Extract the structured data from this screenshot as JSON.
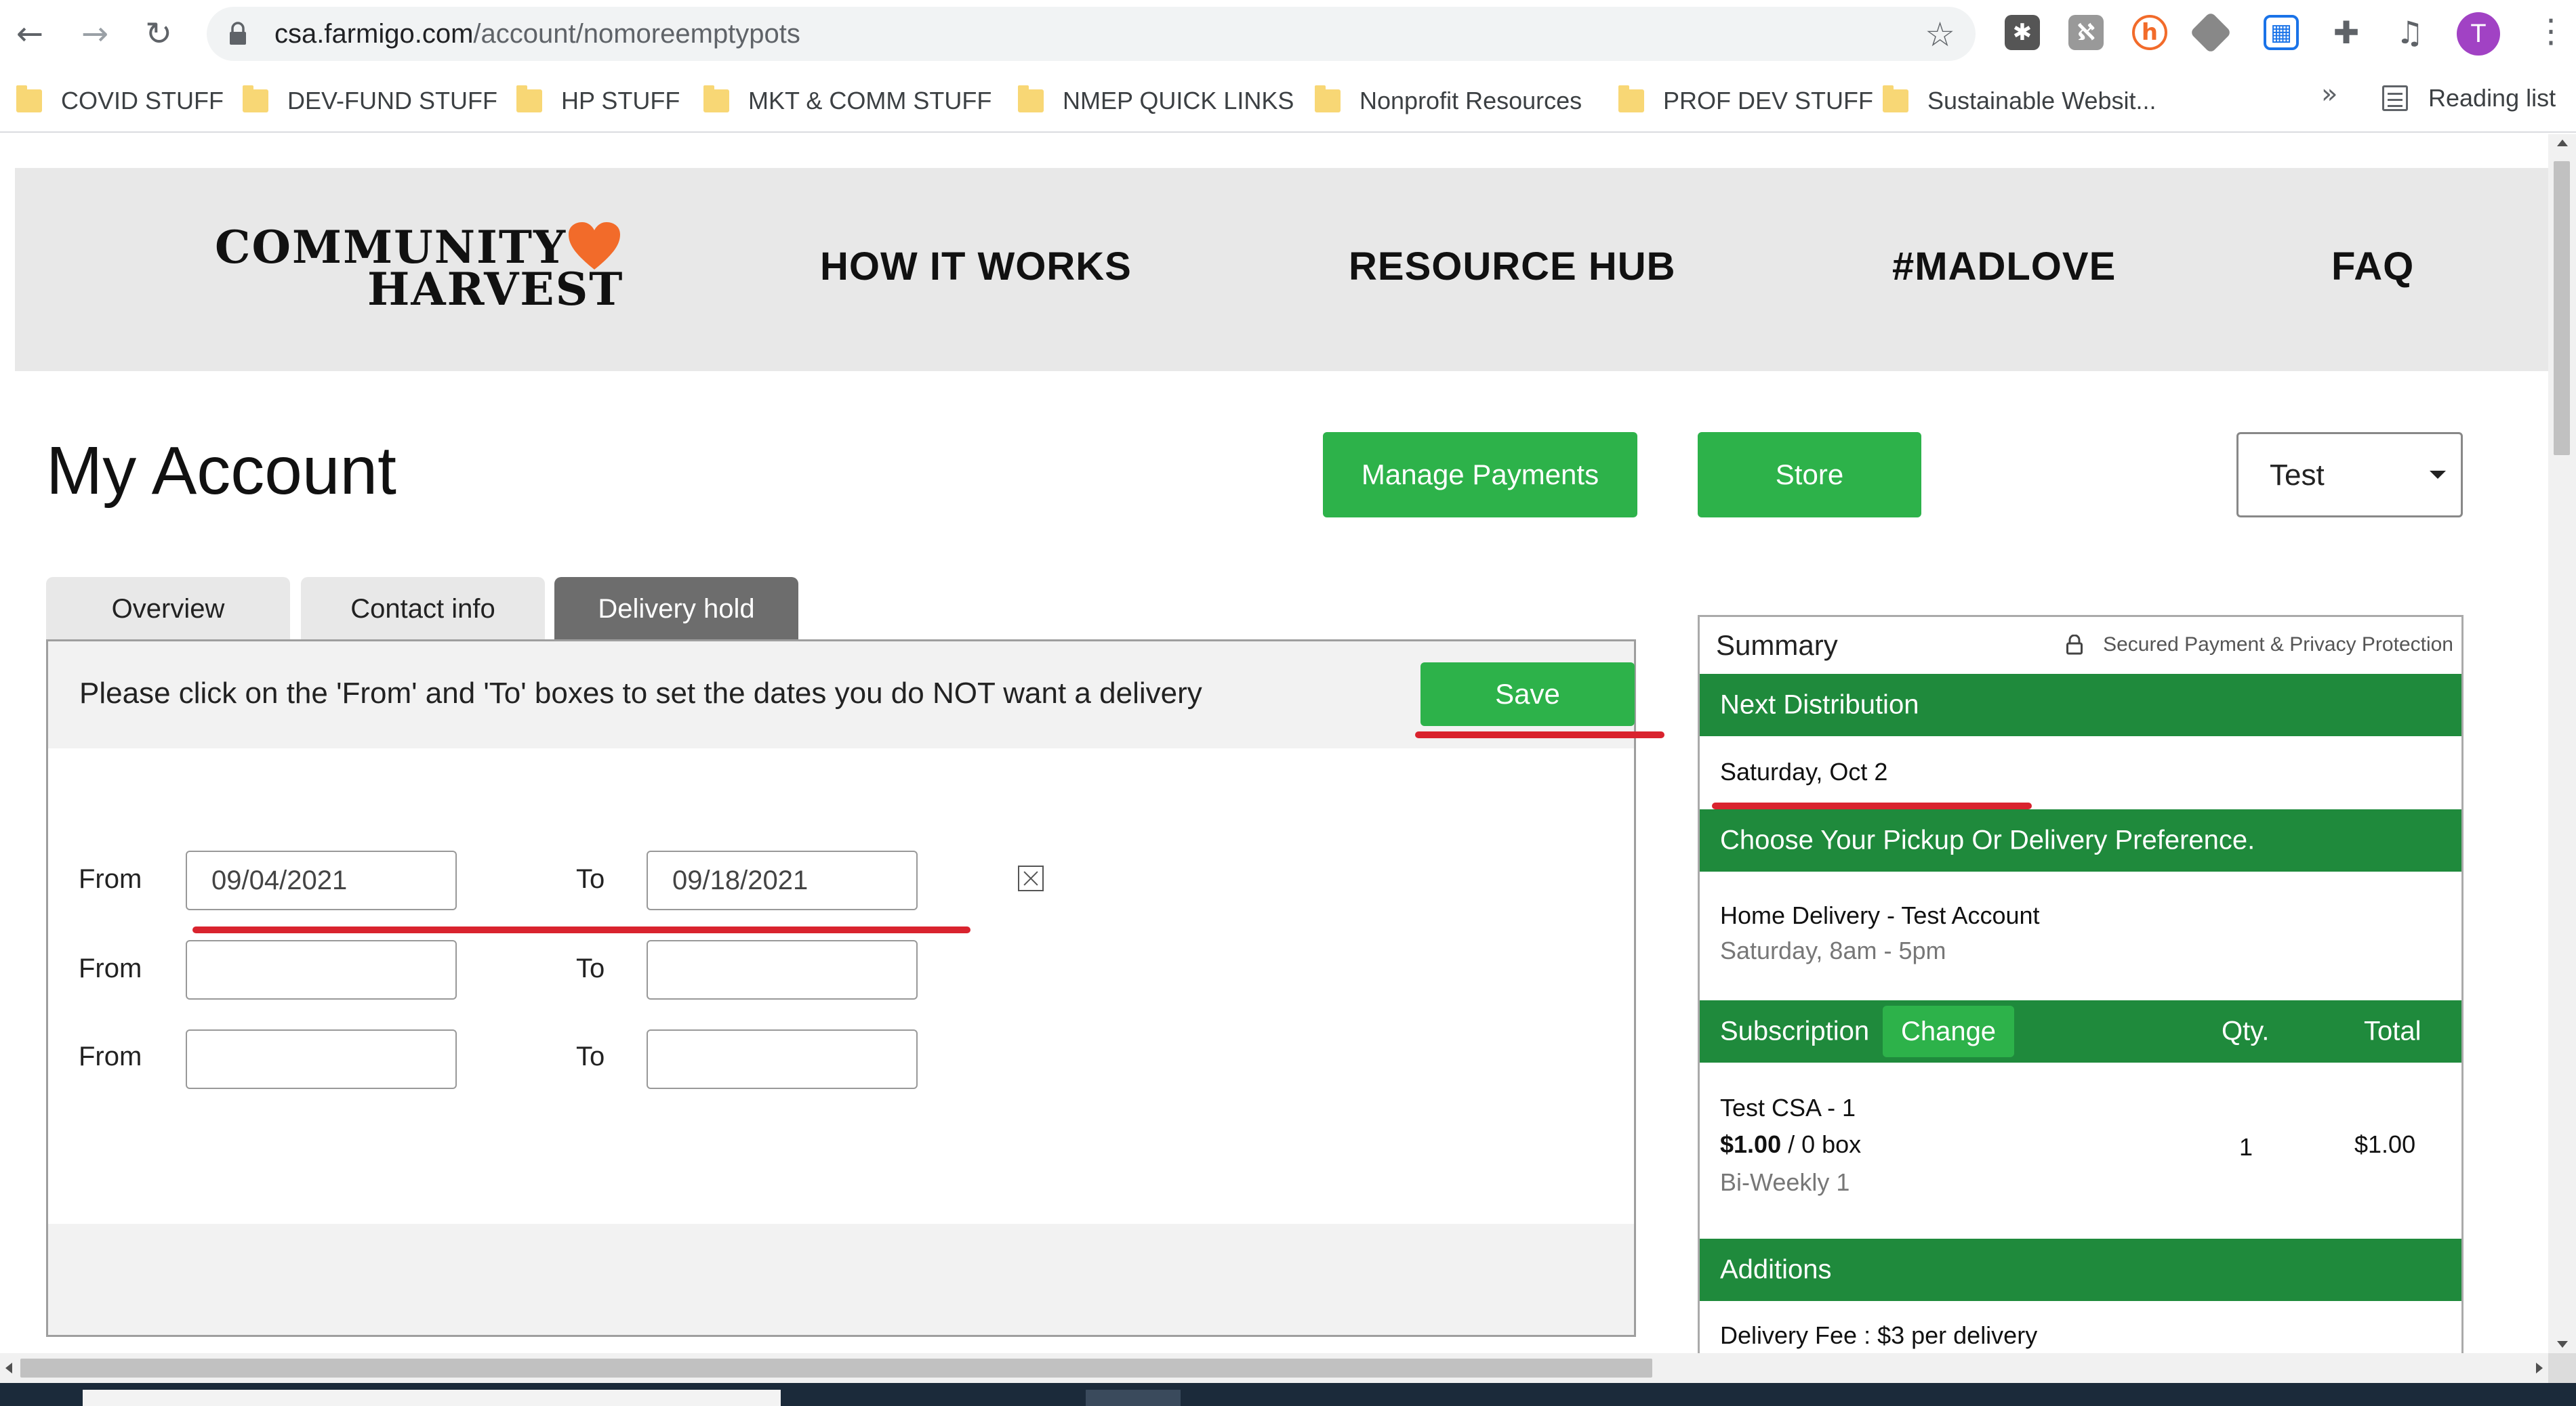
{
  "browser": {
    "url_domain": "csa.farmigo.com",
    "url_path": "/account/nomoreemptypots",
    "profile_initial": "T",
    "reading_list_label": "Reading list",
    "bookmarks": [
      "COVID STUFF",
      "DEV-FUND STUFF",
      "HP STUFF",
      "MKT & COMM STUFF",
      "NMEP QUICK LINKS",
      "Nonprofit Resources",
      "PROF DEV STUFF",
      "Sustainable Websit..."
    ],
    "more_bookmarks": "»",
    "nav_icons": {
      "back": "back-arrow-icon",
      "forward": "forward-arrow-icon",
      "reload": "reload-icon",
      "star": "star-icon",
      "menu": "kebab-menu-icon"
    },
    "extensions": [
      "hubspot-icon",
      "clipboard-extension-icon",
      "honey-extension-icon",
      "diamond-extension-icon",
      "screen-capture-extension-icon",
      "puzzle-icon",
      "media-control-icon"
    ]
  },
  "site": {
    "logo_line1": "COMMUNITY",
    "logo_line2": "HARVEST",
    "nav": [
      "HOW IT WORKS",
      "RESOURCE HUB",
      "#MADLOVE",
      "FAQ"
    ],
    "brand_green": "#2db24a",
    "dark_green": "#1f8a3c",
    "heart_color": "#f26b2a"
  },
  "account": {
    "title": "My Account",
    "manage_payments": "Manage Payments",
    "store": "Store",
    "account_select": "Test"
  },
  "tabs": [
    "Overview",
    "Contact info",
    "Delivery hold"
  ],
  "active_tab": "Delivery hold",
  "hold": {
    "message": "Please click on the 'From' and 'To' boxes to set the dates you do NOT want a delivery",
    "save": "Save",
    "from_label": "From",
    "to_label": "To",
    "rows": [
      {
        "from": "09/04/2021",
        "to": "09/18/2021"
      },
      {
        "from": "",
        "to": ""
      },
      {
        "from": "",
        "to": ""
      }
    ]
  },
  "summary": {
    "heading": "Summary",
    "secured": "Secured Payment & Privacy Protection",
    "next_distribution_label": "Next Distribution",
    "next_distribution_date": "Saturday, Oct 2",
    "pickup_label": "Choose Your Pickup Or Delivery Preference.",
    "delivery_name": "Home Delivery - Test Account",
    "delivery_time": "Saturday, 8am - 5pm",
    "subscription_label": "Subscription",
    "change": "Change",
    "qty_label": "Qty.",
    "total_label": "Total",
    "item_name": "Test CSA - 1",
    "item_price": "$1.00",
    "item_unit": "/ 0 box",
    "item_frequency": "Bi-Weekly 1",
    "item_qty": "1",
    "item_total": "$1.00",
    "additions_label": "Additions",
    "delivery_fee": "Delivery Fee : $3 per delivery"
  }
}
